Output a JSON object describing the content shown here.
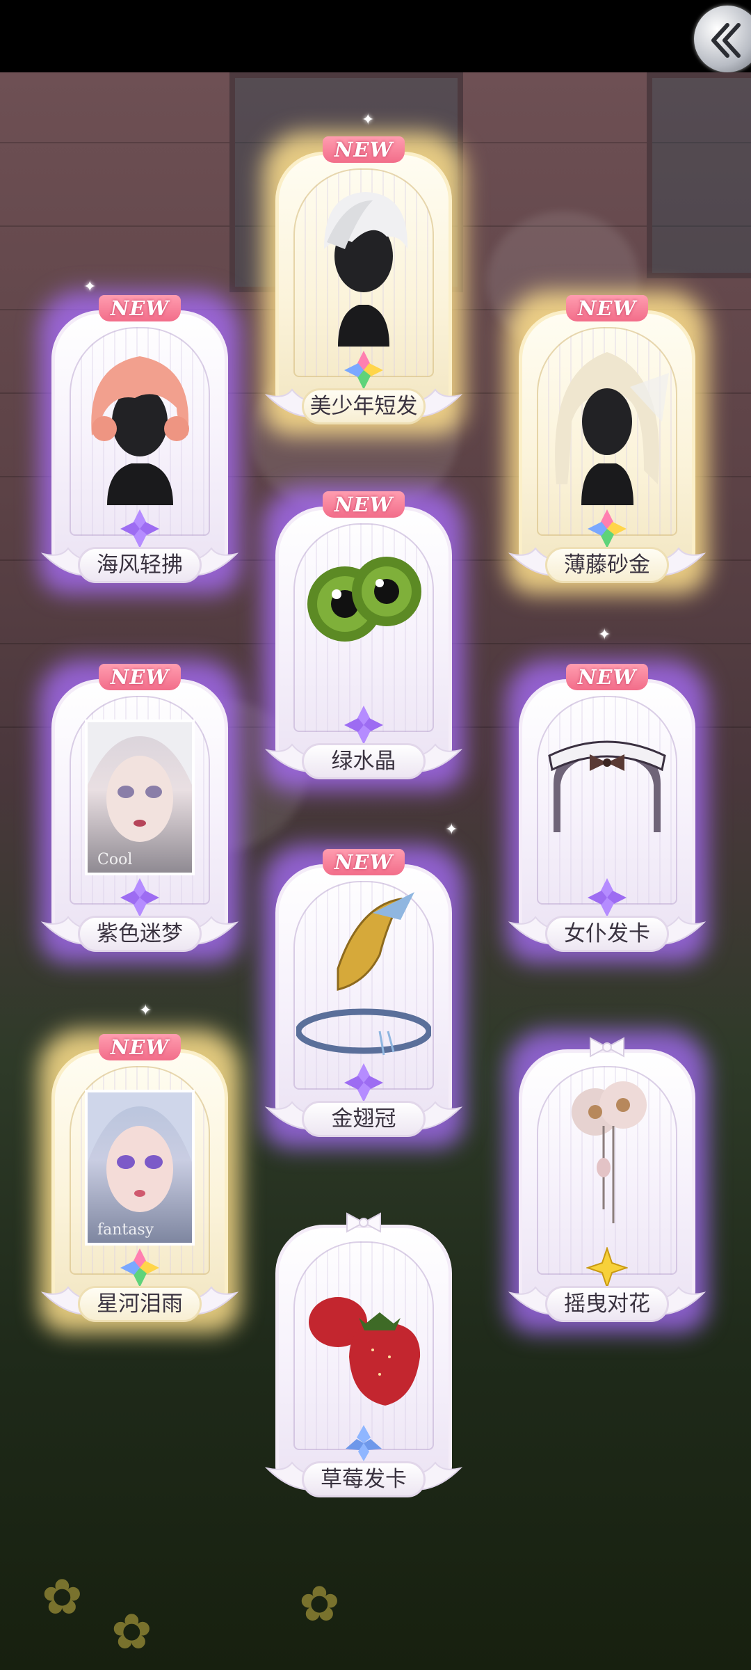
{
  "header": {
    "back_icon": "back-chevron-icon"
  },
  "badge_text": "NEW",
  "colors": {
    "purple_glow": "#aa6eff",
    "gold_glow": "#ffe18c",
    "badge_pink": "#f26d8a"
  },
  "items": [
    {
      "name": "美少年短发",
      "new": true,
      "rarity_glow": "gold",
      "gem": "rainbow",
      "type": "hair"
    },
    {
      "name": "海风轻拂",
      "new": true,
      "rarity_glow": "purple",
      "gem": "purple",
      "type": "hair"
    },
    {
      "name": "薄藤砂金",
      "new": true,
      "rarity_glow": "gold",
      "gem": "rainbow",
      "type": "hair"
    },
    {
      "name": "绿水晶",
      "new": true,
      "rarity_glow": "purple",
      "gem": "purple",
      "type": "eyes"
    },
    {
      "name": "紫色迷梦",
      "new": true,
      "rarity_glow": "purple",
      "gem": "purple",
      "type": "makeup",
      "photo_caption": "Cool"
    },
    {
      "name": "女仆发卡",
      "new": true,
      "rarity_glow": "purple",
      "gem": "purple",
      "type": "headband"
    },
    {
      "name": "金翅冠",
      "new": true,
      "rarity_glow": "purple",
      "gem": "purple",
      "type": "crown"
    },
    {
      "name": "星河泪雨",
      "new": true,
      "rarity_glow": "gold",
      "gem": "rainbow",
      "type": "makeup",
      "photo_caption": "fantasy"
    },
    {
      "name": "摇曳对花",
      "new": false,
      "rarity_glow": "purple",
      "gem": "yellow",
      "type": "hairpin"
    },
    {
      "name": "草莓发卡",
      "new": false,
      "rarity_glow": "none",
      "gem": "blue",
      "type": "hairclip"
    }
  ]
}
